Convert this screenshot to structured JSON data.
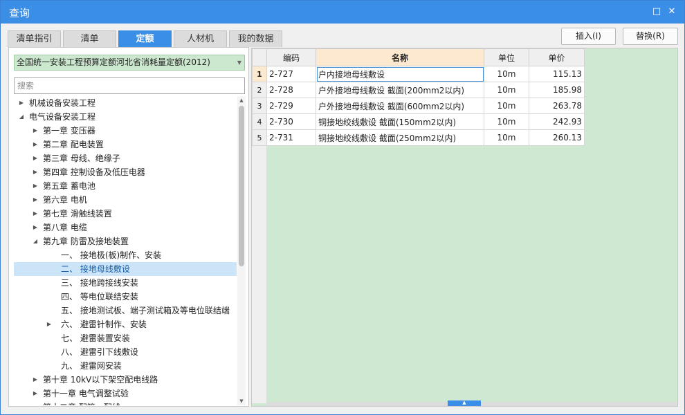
{
  "window": {
    "title": "查询",
    "restore_symbol": "□",
    "close_symbol": "✕"
  },
  "tabs": [
    {
      "label": "清单指引"
    },
    {
      "label": "清单"
    },
    {
      "label": "定额"
    },
    {
      "label": "人材机"
    },
    {
      "label": "我的数据"
    }
  ],
  "toolbar": {
    "insert_label": "插入(I)",
    "replace_label": "替换(R)"
  },
  "left": {
    "selector_value": "全国统一安装工程预算定额河北省消耗量定额(2012)",
    "search_placeholder": "搜索",
    "tree": [
      {
        "label": "机械设备安装工程",
        "level": 0,
        "toggle": "collapsed"
      },
      {
        "label": "电气设备安装工程",
        "level": 0,
        "toggle": "expanded"
      },
      {
        "label": "第一章 变压器",
        "level": 1,
        "toggle": "collapsed"
      },
      {
        "label": "第二章 配电装置",
        "level": 1,
        "toggle": "collapsed"
      },
      {
        "label": "第三章 母线、绝缘子",
        "level": 1,
        "toggle": "collapsed"
      },
      {
        "label": "第四章 控制设备及低压电器",
        "level": 1,
        "toggle": "collapsed"
      },
      {
        "label": "第五章 蓄电池",
        "level": 1,
        "toggle": "collapsed"
      },
      {
        "label": "第六章 电机",
        "level": 1,
        "toggle": "collapsed"
      },
      {
        "label": "第七章 滑触线装置",
        "level": 1,
        "toggle": "collapsed"
      },
      {
        "label": "第八章 电缆",
        "level": 1,
        "toggle": "collapsed"
      },
      {
        "label": "第九章 防雷及接地装置",
        "level": 1,
        "toggle": "expanded"
      },
      {
        "label": "一、 接地极(板)制作、安装",
        "level": 2,
        "toggle": "none"
      },
      {
        "label": "二、 接地母线敷设",
        "level": 2,
        "toggle": "none",
        "selected": true
      },
      {
        "label": "三、 接地跨接线安装",
        "level": 2,
        "toggle": "none"
      },
      {
        "label": "四、 等电位联结安装",
        "level": 2,
        "toggle": "none"
      },
      {
        "label": "五、 接地测试板、端子测试箱及等电位联结端",
        "level": 2,
        "toggle": "none"
      },
      {
        "label": "六、 避雷针制作、安装",
        "level": 2,
        "toggle": "collapsed"
      },
      {
        "label": "七、 避雷装置安装",
        "level": 2,
        "toggle": "none"
      },
      {
        "label": "八、 避雷引下线敷设",
        "level": 2,
        "toggle": "none"
      },
      {
        "label": "九、 避雷网安装",
        "level": 2,
        "toggle": "none"
      },
      {
        "label": "第十章 10kV以下架空配电线路",
        "level": 1,
        "toggle": "collapsed"
      },
      {
        "label": "第十一章 电气调整试验",
        "level": 1,
        "toggle": "collapsed"
      },
      {
        "label": "第十二章 配管、配线",
        "level": 1,
        "toggle": "collapsed"
      }
    ]
  },
  "grid": {
    "columns": {
      "code": "编码",
      "name": "名称",
      "unit": "单位",
      "price": "单价"
    },
    "rows": [
      {
        "idx": "1",
        "code": "2-727",
        "name": "户内接地母线敷设",
        "unit": "10m",
        "price": "115.13",
        "current": true
      },
      {
        "idx": "2",
        "code": "2-728",
        "name": "户外接地母线敷设 截面(200mm2以内)",
        "unit": "10m",
        "price": "185.98"
      },
      {
        "idx": "3",
        "code": "2-729",
        "name": "户外接地母线敷设 截面(600mm2以内)",
        "unit": "10m",
        "price": "263.78"
      },
      {
        "idx": "4",
        "code": "2-730",
        "name": "铜接地绞线敷设 截面(150mm2以内)",
        "unit": "10m",
        "price": "242.93"
      },
      {
        "idx": "5",
        "code": "2-731",
        "name": "铜接地绞线敷设 截面(250mm2以内)",
        "unit": "10m",
        "price": "260.13"
      }
    ]
  }
}
